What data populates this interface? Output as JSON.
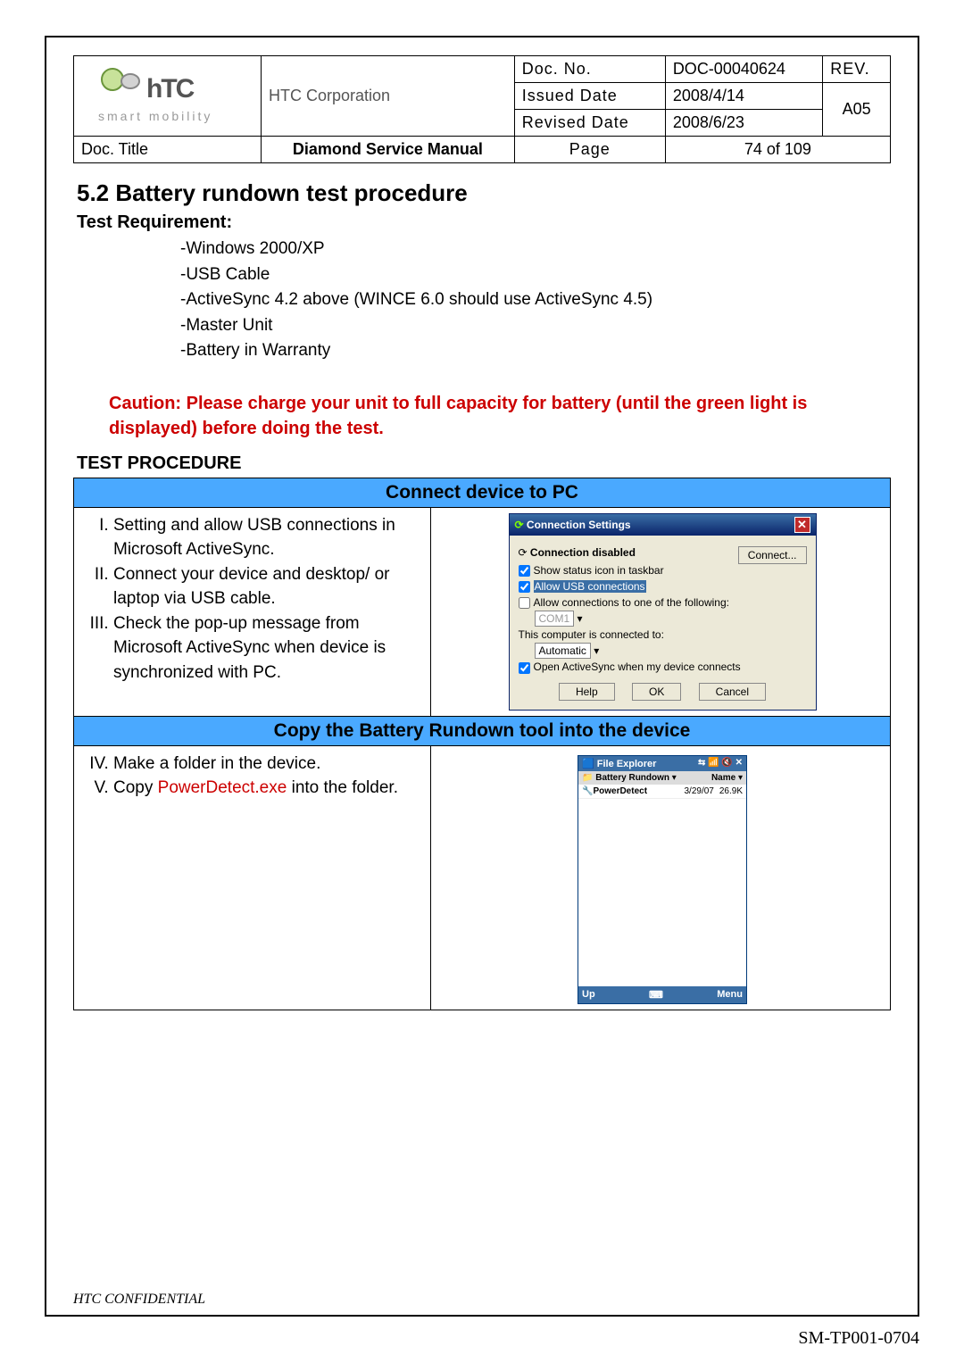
{
  "meta": {
    "corp": "HTC Corporation",
    "logo_tag": "smart mobility",
    "doc_no_lbl": "Doc. No.",
    "doc_no": "DOC-00040624",
    "rev_lbl": "REV.",
    "rev": "A05",
    "issued_lbl": "Issued Date",
    "issued": "2008/4/14",
    "revised_lbl": "Revised Date",
    "revised": "2008/6/23",
    "doc_title_lbl": "Doc. Title",
    "doc_title": "Diamond Service Manual",
    "page_lbl": "Page",
    "page": "74  of  109"
  },
  "section": {
    "num": "5.2  Battery rundown test procedure",
    "req_head": "Test Requirement:",
    "reqs": [
      "-Windows 2000/XP",
      "-USB Cable",
      "-ActiveSync 4.2 above (WINCE 6.0 should use ActiveSync 4.5)",
      "-Master Unit",
      "-Battery in Warranty"
    ],
    "caution": "Caution: Please charge your unit to full capacity for battery (until the green light is displayed) before doing the test.",
    "proc_head": "TEST PROCEDURE"
  },
  "table": {
    "head1": "Connect device to PC",
    "head2": "Copy the Battery Rundown tool into the device",
    "steps1": [
      "Setting and allow USB connections in Microsoft ActiveSync.",
      "Connect your device and desktop/ or laptop via USB cable.",
      "Check the pop-up message from Microsoft ActiveSync when device is synchronized with PC."
    ],
    "steps2_prefix4": "Make a folder in the device.",
    "steps2_prefix5a": "Copy ",
    "steps2_prefix5b": "PowerDetect.exe",
    "steps2_prefix5c": " into the folder."
  },
  "activesync": {
    "title": "Connection Settings",
    "disabled": "Connection disabled",
    "connect": "Connect...",
    "show_status": "Show status icon in taskbar",
    "allow_usb": "Allow USB connections",
    "allow_one": "Allow connections to one of the following:",
    "com": "COM1",
    "this_pc": "This computer is connected to:",
    "auto": "Automatic",
    "open_as": "Open ActiveSync when my device connects",
    "help": "Help",
    "ok": "OK",
    "cancel": "Cancel"
  },
  "fileexplorer": {
    "title": "File Explorer",
    "folder": "Battery Rundown",
    "name": "Name",
    "file": "PowerDetect",
    "date": "3/29/07",
    "size": "26.9K",
    "up": "Up",
    "menu": "Menu"
  },
  "footer": {
    "conf": "HTC CONFIDENTIAL",
    "code": "SM-TP001-0704"
  }
}
